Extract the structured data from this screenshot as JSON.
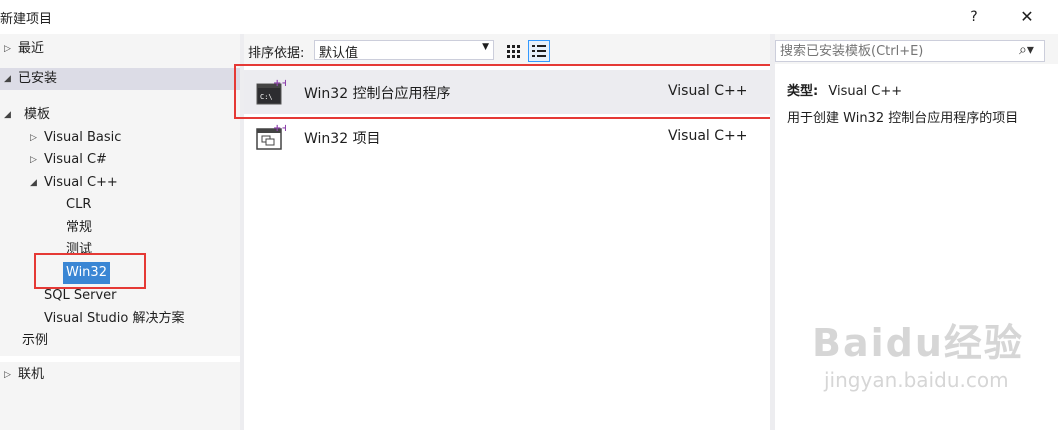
{
  "window": {
    "title": "新建项目",
    "help_label": "?",
    "close_label": "✕"
  },
  "sidebar": {
    "recent": "最近",
    "installed": "已安装",
    "templates": "模板",
    "items": [
      {
        "label": "Visual Basic"
      },
      {
        "label": "Visual C#"
      },
      {
        "label": "Visual C++"
      },
      {
        "label": "CLR"
      },
      {
        "label": "常规"
      },
      {
        "label": "测试"
      },
      {
        "label": "Win32"
      },
      {
        "label": "SQL Server"
      },
      {
        "label": "Visual Studio 解决方案"
      },
      {
        "label": "示例"
      }
    ],
    "online": "联机",
    "expand_glyph": "▷",
    "collapse_glyph": "◢"
  },
  "sort": {
    "label": "排序依据:",
    "value": "默认值"
  },
  "templates": [
    {
      "name": "Win32 控制台应用程序",
      "lang": "Visual C++",
      "icon": "console-app-icon"
    },
    {
      "name": "Win32 项目",
      "lang": "Visual C++",
      "icon": "win32-project-icon"
    }
  ],
  "search": {
    "placeholder": "搜索已安装模板(Ctrl+E)",
    "icon": "search-icon"
  },
  "details": {
    "type_label": "类型:",
    "type_value": "Visual C++",
    "description": "用于创建 Win32 控制台应用程序的项目"
  },
  "watermark": {
    "logo": "Baidu经验",
    "url": "jingyan.baidu.com"
  },
  "colors": {
    "selection_blue": "#3a86d4",
    "highlight_red": "#e53935",
    "panel_bg": "#f5f5f5"
  }
}
